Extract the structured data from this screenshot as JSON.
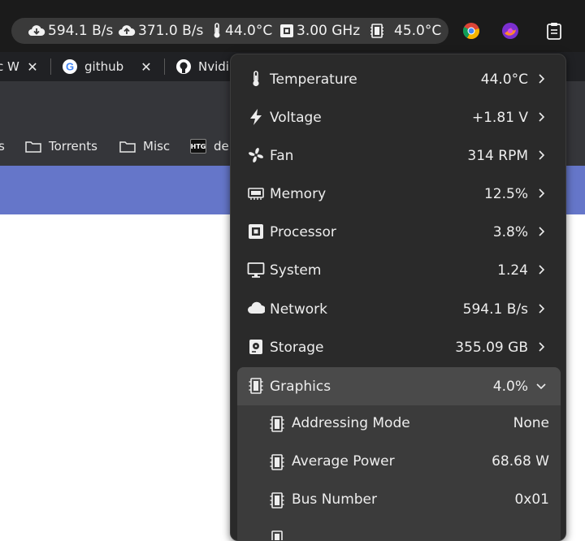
{
  "panel": {
    "indicators": [
      {
        "icon": "cloud-download-icon",
        "text": "594.1 B/s"
      },
      {
        "icon": "cloud-upload-icon",
        "text": "371.0 B/s"
      },
      {
        "icon": "thermometer-icon",
        "text": "44.0°C"
      },
      {
        "icon": "processor-icon",
        "text": "3.00 GHz"
      },
      {
        "icon": "gpu-icon",
        "text": "45.0°C"
      }
    ],
    "tray": [
      "chrome-icon",
      "firefox-icon",
      "clipboard-icon"
    ]
  },
  "browser": {
    "tabs": [
      {
        "title": "c W",
        "icon": "none"
      },
      {
        "title": "github",
        "icon": "google-icon"
      },
      {
        "title": "Nvidi",
        "icon": "github-icon"
      }
    ],
    "bookmarks": [
      {
        "label": "s",
        "icon": "none"
      },
      {
        "label": "Torrents",
        "icon": "folder-icon"
      },
      {
        "label": "Misc",
        "icon": "folder-icon"
      },
      {
        "label": "de",
        "icon": "htg-icon",
        "badge": "HTG"
      }
    ]
  },
  "menu": {
    "items": [
      {
        "label": "Temperature",
        "value": "44.0°C",
        "icon": "thermometer-icon"
      },
      {
        "label": "Voltage",
        "value": "+1.81 V",
        "icon": "lightning-icon"
      },
      {
        "label": "Fan",
        "value": "314 RPM",
        "icon": "fan-icon"
      },
      {
        "label": "Memory",
        "value": "12.5%",
        "icon": "memory-icon"
      },
      {
        "label": "Processor",
        "value": "3.8%",
        "icon": "processor-icon"
      },
      {
        "label": "System",
        "value": "1.24",
        "icon": "monitor-icon"
      },
      {
        "label": "Network",
        "value": "594.1 B/s",
        "icon": "cloud-icon"
      },
      {
        "label": "Storage",
        "value": "355.09 GB",
        "icon": "storage-icon"
      }
    ],
    "graphics": {
      "label": "Graphics",
      "value": "4.0%",
      "icon": "gpu-icon",
      "expanded": true,
      "children": [
        {
          "label": "Addressing Mode",
          "value": "None"
        },
        {
          "label": "Average Power",
          "value": "68.68 W"
        },
        {
          "label": "Bus Number",
          "value": "0x01"
        }
      ]
    }
  },
  "colors": {
    "panel_bg": "#1b1b1b",
    "pill_bg": "#3a3a3a",
    "menu_bg": "#2a2a2a",
    "section_bg": "#3b3b3b",
    "section_header_bg": "#4a4a4a",
    "banner": "#6576c9"
  }
}
